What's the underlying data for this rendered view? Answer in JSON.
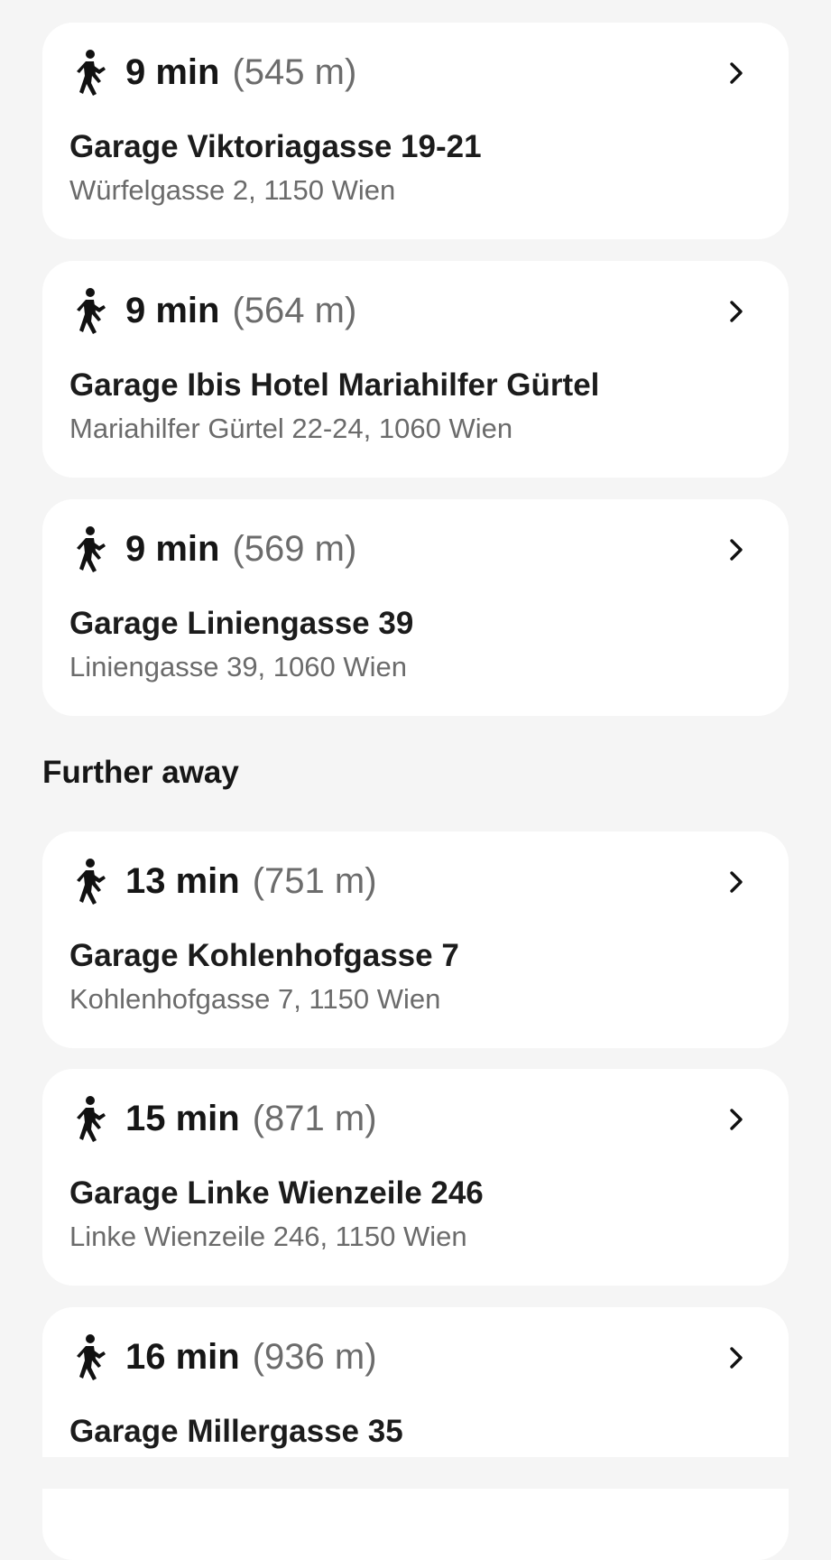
{
  "top_cards": [
    {
      "time": "9 min",
      "distance": "(545 m)",
      "name": "Garage Viktoriagasse 19-21",
      "address": "Würfelgasse 2, 1150 Wien"
    },
    {
      "time": "9 min",
      "distance": "(564 m)",
      "name": "Garage Ibis Hotel Mariahilfer Gürtel",
      "address": "Mariahilfer Gürtel 22-24, 1060 Wien"
    },
    {
      "time": "9 min",
      "distance": "(569 m)",
      "name": "Garage Liniengasse 39",
      "address": "Liniengasse 39, 1060 Wien"
    }
  ],
  "section_header": "Further away",
  "further_cards": [
    {
      "time": "13 min",
      "distance": "(751 m)",
      "name": "Garage Kohlenhofgasse 7",
      "address": "Kohlenhofgasse 7, 1150 Wien"
    },
    {
      "time": "15 min",
      "distance": "(871 m)",
      "name": "Garage Linke Wienzeile 246",
      "address": "Linke Wienzeile 246, 1150 Wien"
    },
    {
      "time": "16 min",
      "distance": "(936 m)",
      "name": "Garage Millergasse 35",
      "address": ""
    }
  ],
  "icons": {
    "walk": "walking-person-icon",
    "chevron": "chevron-right-icon"
  },
  "colors": {
    "background": "#f5f5f5",
    "card": "#ffffff",
    "primary_text": "#161616",
    "secondary_text": "#6b6b6b"
  }
}
